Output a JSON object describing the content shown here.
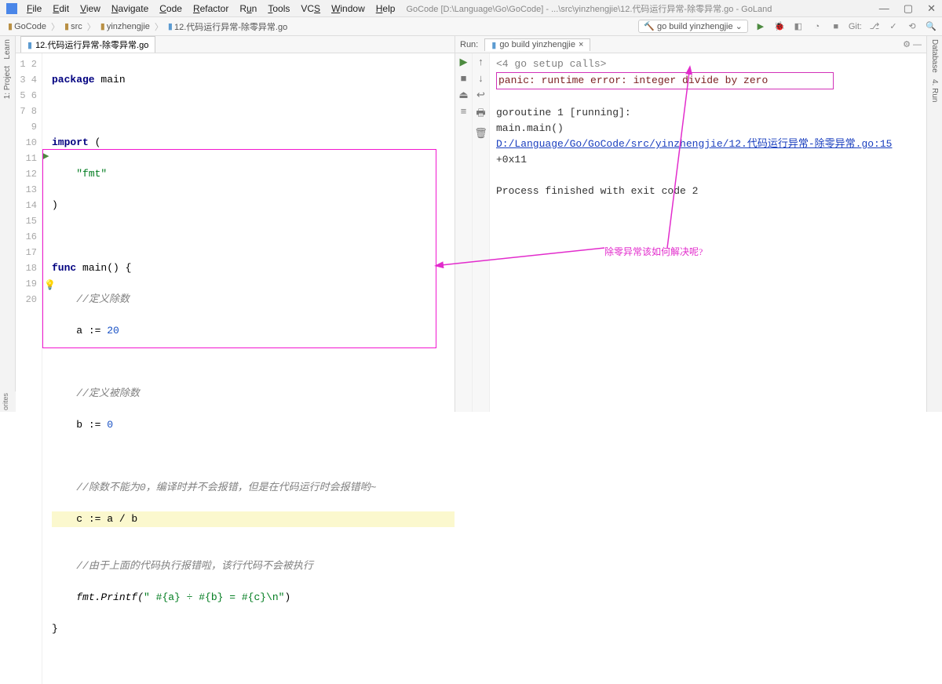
{
  "title": {
    "path": "GoCode [D:\\Language\\Go\\GoCode] - ...\\src\\yinzhengjie\\12.代码运行异常-除零异常.go - GoLand"
  },
  "menu": [
    "File",
    "Edit",
    "View",
    "Navigate",
    "Code",
    "Refactor",
    "Run",
    "Tools",
    "VCS",
    "Window",
    "Help"
  ],
  "breadcrumb": {
    "root": "GoCode",
    "src": "src",
    "pkg": "yinzhengjie",
    "file": "12.代码运行异常-除零异常.go"
  },
  "runcfg": "go build yinzhengjie",
  "git_label": "Git:",
  "editor_tab": "12.代码运行异常-除零异常.go",
  "code": {
    "l1a": "package",
    "l1b": " main",
    "l3a": "import",
    "l3b": " (",
    "l4": "\"fmt\"",
    "l5": ")",
    "l7a": "func",
    "l7b": " main() {",
    "l8": "//定义除数",
    "l9a": "a := ",
    "l9b": "20",
    "l11": "//定义被除数",
    "l12a": "b := ",
    "l12b": "0",
    "l14": "//除数不能为0，编译时并不会报错，但是在代码运行时会报错哟~",
    "l15": "c := a / b",
    "l17": "//由于上面的代码执行报错啦，该行代码不会被执行",
    "l18a": "fmt.Printf(",
    "l18b": "\" #{a} ÷ #{b} = #{c}\\n\"",
    "l18c": ")",
    "l19": "}"
  },
  "gutter": [
    "1",
    "2",
    "3",
    "4",
    "5",
    "6",
    "7",
    "8",
    "9",
    "10",
    "11",
    "12",
    "13",
    "14",
    "15",
    "16",
    "17",
    "18",
    "19",
    "20"
  ],
  "run": {
    "label": "Run:",
    "tab": "go build yinzhengjie",
    "folded": "<4 go setup calls>",
    "panic": "panic: runtime error: integer divide by zero",
    "gor": "goroutine 1 [running]:",
    "mm": "main.main()",
    "link": "D:/Language/Go/GoCode/src/yinzhengjie/12.代码运行异常-除零异常.go:15",
    "off": " +0x11",
    "exit": "Process finished with exit code 2"
  },
  "annotation": "除零异常该如何解决呢?",
  "sidetabs": {
    "learn": "Learn",
    "project": "1: Project",
    "database": "Database",
    "sciview": "4. Run",
    "favorites": "orites"
  }
}
